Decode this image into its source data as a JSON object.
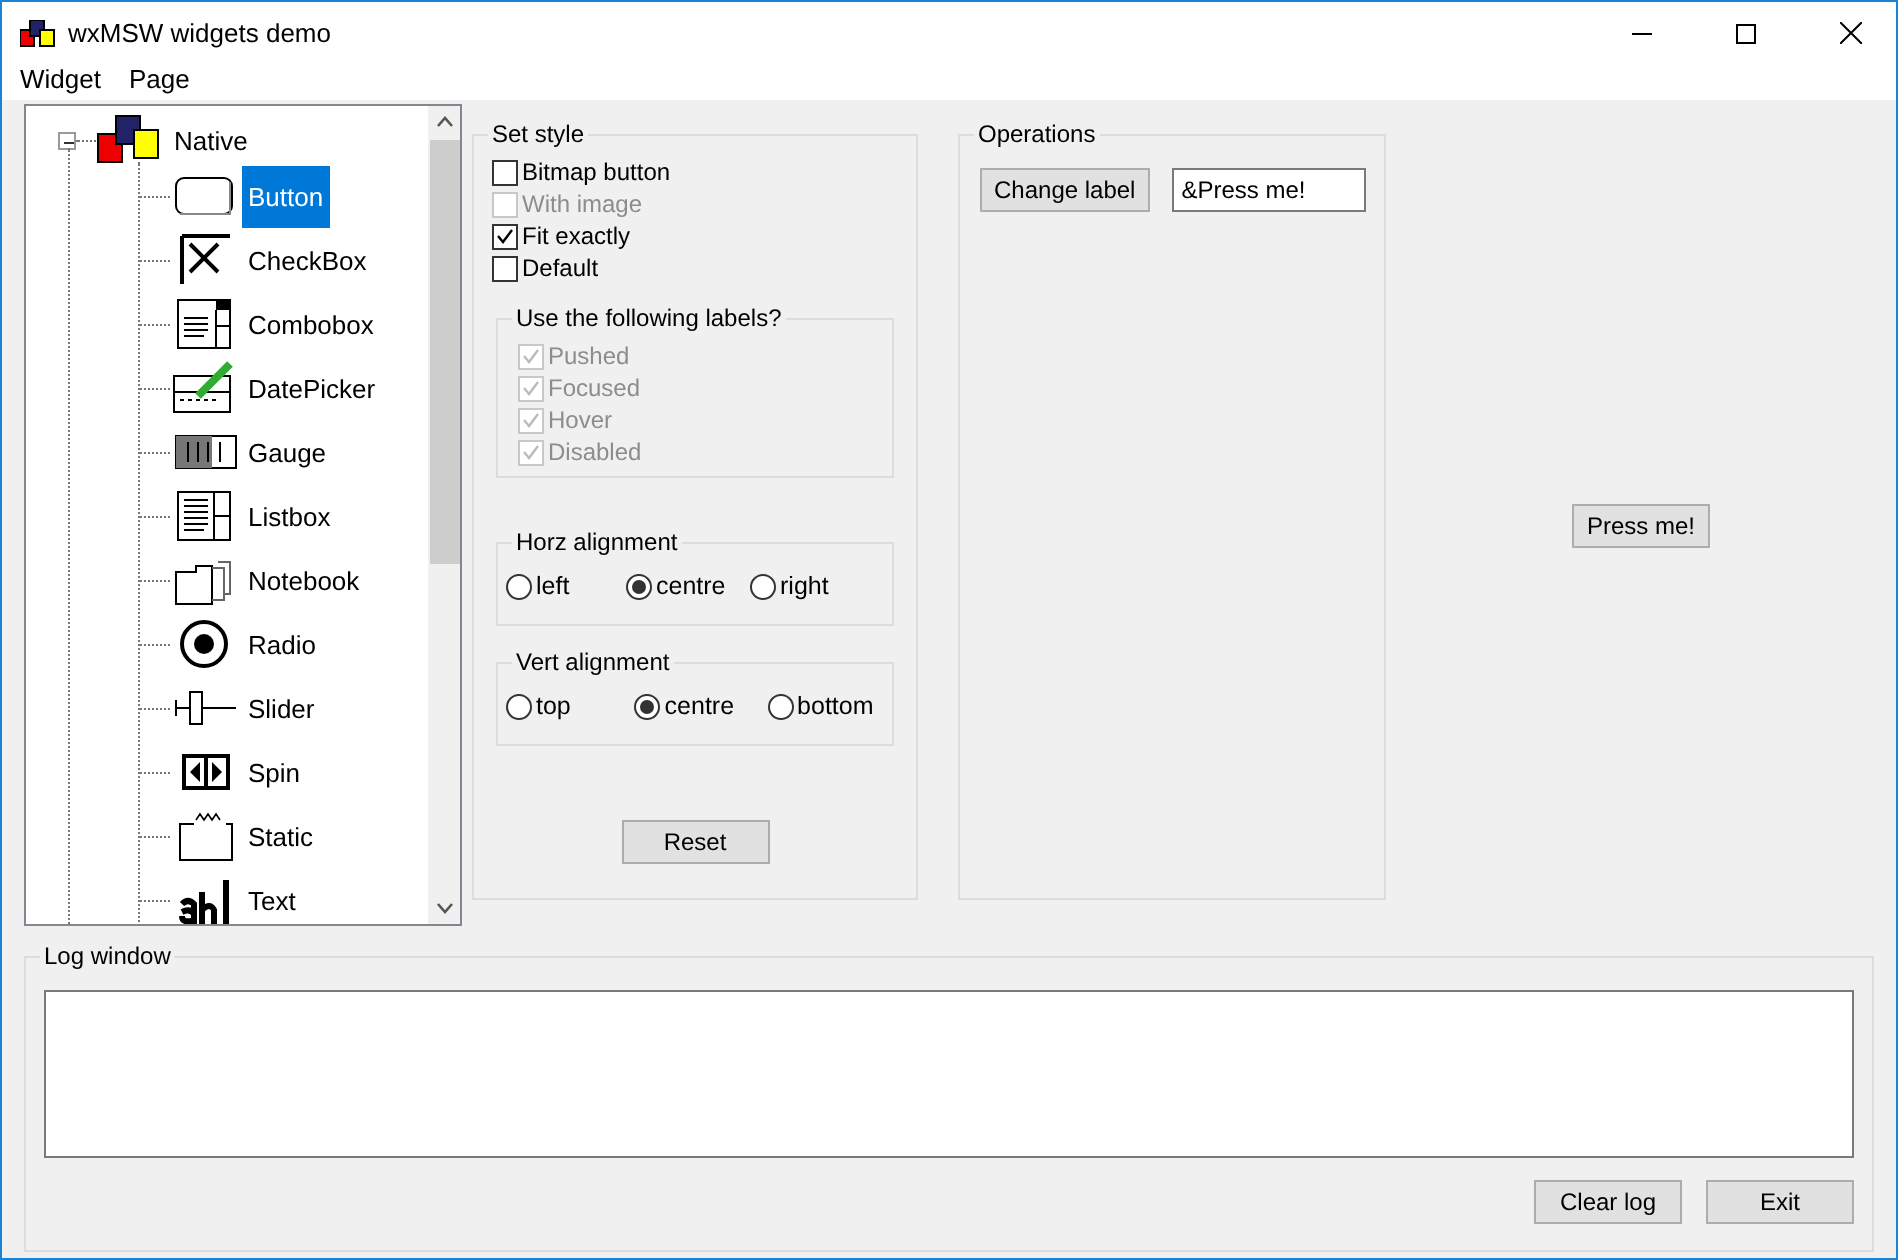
{
  "window": {
    "title": "wxMSW widgets demo"
  },
  "menu": [
    "Widget",
    "Page"
  ],
  "tree": {
    "label": "Native",
    "expanded": true,
    "children": [
      {
        "label": "Button",
        "selected": true
      },
      {
        "label": "CheckBox",
        "selected": false
      },
      {
        "label": "Combobox",
        "selected": false
      },
      {
        "label": "DatePicker",
        "selected": false
      },
      {
        "label": "Gauge",
        "selected": false
      },
      {
        "label": "Listbox",
        "selected": false
      },
      {
        "label": "Notebook",
        "selected": false
      },
      {
        "label": "Radio",
        "selected": false
      },
      {
        "label": "Slider",
        "selected": false
      },
      {
        "label": "Spin",
        "selected": false
      },
      {
        "label": "Static",
        "selected": false
      },
      {
        "label": "Text",
        "selected": false
      }
    ]
  },
  "set_style": {
    "title": "Set style",
    "checkboxes": [
      {
        "label": "Bitmap button",
        "checked": false,
        "disabled": false
      },
      {
        "label": "With image",
        "checked": false,
        "disabled": true
      },
      {
        "label": "Fit exactly",
        "checked": true,
        "disabled": false
      },
      {
        "label": "Default",
        "checked": false,
        "disabled": false
      }
    ],
    "labels_group": {
      "title": "Use the following labels?",
      "checkboxes": [
        {
          "label": "Pushed",
          "checked": true,
          "disabled": true
        },
        {
          "label": "Focused",
          "checked": true,
          "disabled": true
        },
        {
          "label": "Hover",
          "checked": true,
          "disabled": true
        },
        {
          "label": "Disabled",
          "checked": true,
          "disabled": true
        }
      ]
    },
    "radio_groups": [
      {
        "title": "Horz alignment",
        "options": [
          {
            "label": "left",
            "selected": false
          },
          {
            "label": "centre",
            "selected": true
          },
          {
            "label": "right",
            "selected": false
          }
        ]
      },
      {
        "title": "Vert alignment",
        "options": [
          {
            "label": "top",
            "selected": false
          },
          {
            "label": "centre",
            "selected": true
          },
          {
            "label": "bottom",
            "selected": false
          }
        ]
      }
    ],
    "reset_button": "Reset"
  },
  "operations": {
    "title": "Operations",
    "button": "Change label",
    "value": "&Press me!"
  },
  "demo_button": "Press me!",
  "log": {
    "title": "Log window",
    "buttons": [
      "Clear log",
      "Exit"
    ]
  }
}
